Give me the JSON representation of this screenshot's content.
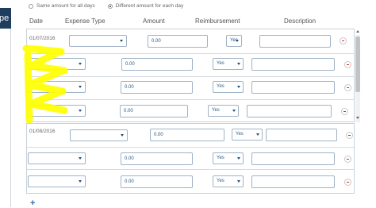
{
  "window": {
    "title_fragment": "pe"
  },
  "mode": {
    "option_same": "Same amount for all days",
    "option_different": "Different amount for each day",
    "selected": "different"
  },
  "columns": {
    "date": "Date",
    "expense_type": "Expense Type",
    "amount": "Amount",
    "reimbursement": "Reimbursement",
    "description": "Description"
  },
  "groups": [
    {
      "date": "01/07/2016",
      "rows": [
        {
          "expense_type": "",
          "amount": "0.00",
          "reimbursement": "Yes",
          "description": ""
        },
        {
          "expense_type": "",
          "amount": "0.00",
          "reimbursement": "Yes",
          "description": ""
        },
        {
          "expense_type": "",
          "amount": "0.00",
          "reimbursement": "Yes",
          "description": ""
        },
        {
          "expense_type": "",
          "amount": "0.00",
          "reimbursement": "Yes",
          "description": ""
        }
      ]
    },
    {
      "date": "01/08/2016",
      "rows": [
        {
          "expense_type": "",
          "amount": "0.00",
          "reimbursement": "Yes",
          "description": ""
        },
        {
          "expense_type": "",
          "amount": "0.00",
          "reimbursement": "Yes",
          "description": ""
        },
        {
          "expense_type": "",
          "amount": "0.00",
          "reimbursement": "Yes",
          "description": ""
        }
      ]
    }
  ],
  "add_button": "+",
  "colors": {
    "accent": "#2f6aa3",
    "remove": "#dd2222",
    "highlight": "#ffff00"
  }
}
